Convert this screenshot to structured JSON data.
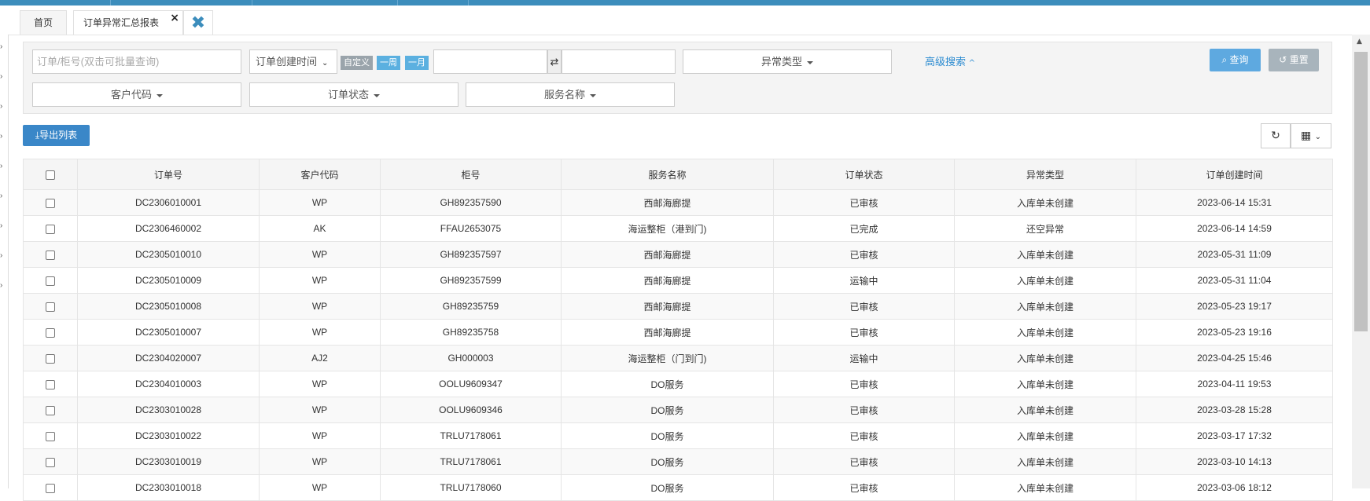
{
  "tabs": {
    "home": "首页",
    "active": "订单异常汇总报表",
    "close_glyph": "×",
    "close_all_glyph": "✖"
  },
  "search": {
    "order_placeholder": "订单/柜号(双击可批量查询)",
    "date_field": "订单创建时间",
    "chip_custom": "自定义",
    "chip_week": "一周",
    "chip_month": "一月",
    "exception_type": "异常类型",
    "advanced": "高级搜索",
    "customer_code": "客户代码",
    "order_status": "订单状态",
    "service_name": "服务名称",
    "query_btn": "查询",
    "reset_btn": "重置"
  },
  "toolbar": {
    "export": "导出列表"
  },
  "table": {
    "headers": [
      "订单号",
      "客户代码",
      "柜号",
      "服务名称",
      "订单状态",
      "异常类型",
      "订单创建时间"
    ],
    "rows": [
      [
        "DC2306010001",
        "WP",
        "GH892357590",
        "西邮海廊提",
        "已审核",
        "入库单未创建",
        "2023-06-14 15:31"
      ],
      [
        "DC2306460002",
        "AK",
        "FFAU2653075",
        "海运整柜（港到门)",
        "已完成",
        "还空异常",
        "2023-06-14 14:59"
      ],
      [
        "DC2305010010",
        "WP",
        "GH892357597",
        "西邮海廊提",
        "已审核",
        "入库单未创建",
        "2023-05-31 11:09"
      ],
      [
        "DC2305010009",
        "WP",
        "GH892357599",
        "西邮海廊提",
        "运输中",
        "入库单未创建",
        "2023-05-31 11:04"
      ],
      [
        "DC2305010008",
        "WP",
        "GH89235759",
        "西邮海廊提",
        "已审核",
        "入库单未创建",
        "2023-05-23 19:17"
      ],
      [
        "DC2305010007",
        "WP",
        "GH89235758",
        "西邮海廊提",
        "已审核",
        "入库单未创建",
        "2023-05-23 19:16"
      ],
      [
        "DC2304020007",
        "AJ2",
        "GH000003",
        "海运整柜（门到门)",
        "运输中",
        "入库单未创建",
        "2023-04-25 15:46"
      ],
      [
        "DC2304010003",
        "WP",
        "OOLU9609347",
        "DO服务",
        "已审核",
        "入库单未创建",
        "2023-04-11 19:53"
      ],
      [
        "DC2303010028",
        "WP",
        "OOLU9609346",
        "DO服务",
        "已审核",
        "入库单未创建",
        "2023-03-28 15:28"
      ],
      [
        "DC2303010022",
        "WP",
        "TRLU7178061",
        "DO服务",
        "已审核",
        "入库单未创建",
        "2023-03-17 17:32"
      ],
      [
        "DC2303010019",
        "WP",
        "TRLU7178061",
        "DO服务",
        "已审核",
        "入库单未创建",
        "2023-03-10 14:13"
      ],
      [
        "DC2303010018",
        "WP",
        "TRLU7178060",
        "DO服务",
        "已审核",
        "入库单未创建",
        "2023-03-06 18:12"
      ]
    ]
  },
  "colors": {
    "accent": "#3c8dbc",
    "query_btn": "#5ea9e0",
    "reset_btn": "#a8b4bc",
    "link": "#2a8ad0"
  }
}
